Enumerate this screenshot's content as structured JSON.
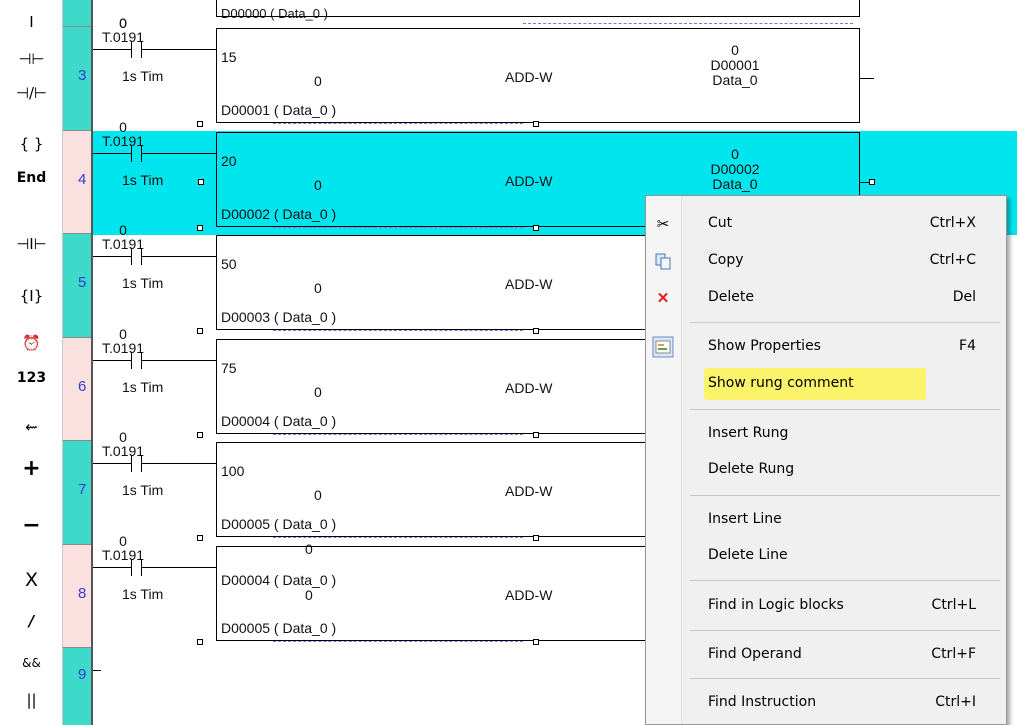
{
  "toolbar": [
    {
      "name": "contact-cursor-tool",
      "glyph": "I"
    },
    {
      "name": "normally-open-contact-tool",
      "glyph": "⊣⊢"
    },
    {
      "name": "normally-closed-contact-tool",
      "glyph": "⊣/⊢"
    },
    {
      "name": "coil-tool",
      "glyph": "{ }"
    },
    {
      "name": "end-tool",
      "glyph": "End"
    },
    {
      "name": "rising-edge-contact-tool",
      "glyph": "⊣I⊢"
    },
    {
      "name": "set-coil-tool",
      "glyph": "{I}"
    },
    {
      "name": "timer-tool",
      "glyph": "⏰"
    },
    {
      "name": "numeric-tool",
      "glyph": "123"
    },
    {
      "name": "move-tool",
      "glyph": "⇜"
    },
    {
      "name": "add-tool",
      "glyph": "+"
    },
    {
      "name": "subtract-tool",
      "glyph": "−"
    },
    {
      "name": "multiply-tool",
      "glyph": "X"
    },
    {
      "name": "divide-tool",
      "glyph": "/"
    },
    {
      "name": "logical-and-tool",
      "glyph": "&&"
    },
    {
      "name": "logical-or-tool",
      "glyph": "||"
    }
  ],
  "top_partial": {
    "zero": "0",
    "operand": "D00000 ( Data_0 )"
  },
  "rungs": [
    {
      "number": "3",
      "contact_value": "0",
      "contact_address": "T.0191",
      "contact_label": "1s Tim",
      "in1": "15",
      "in2_value": "0",
      "in2": "D00001 ( Data_0 )",
      "instruction": "ADD-W",
      "out_value": "0",
      "out_address": "D00001",
      "out_label": "Data_0",
      "selected": false
    },
    {
      "number": "4",
      "contact_value": "0",
      "contact_address": "T.0191",
      "contact_label": "1s Tim",
      "in1": "20",
      "in2_value": "0",
      "in2": "D00002 ( Data_0 )",
      "instruction": "ADD-W",
      "out_value": "0",
      "out_address": "D00002",
      "out_label": "Data_0",
      "selected": true
    },
    {
      "number": "5",
      "contact_value": "0",
      "contact_address": "T.0191",
      "contact_label": "1s Tim",
      "in1": "50",
      "in2_value": "0",
      "in2": "D00003 ( Data_0 )",
      "instruction": "ADD-W",
      "selected": false
    },
    {
      "number": "6",
      "contact_value": "0",
      "contact_address": "T.0191",
      "contact_label": "1s Tim",
      "in1": "75",
      "in2_value": "0",
      "in2": "D00004 ( Data_0 )",
      "instruction": "ADD-W",
      "selected": false
    },
    {
      "number": "7",
      "contact_value": "0",
      "contact_address": "T.0191",
      "contact_label": "1s Tim",
      "in1": "100",
      "in2_value": "0",
      "in2": "D00005 ( Data_0 )",
      "instruction": "ADD-W",
      "selected": false
    },
    {
      "number": "8",
      "contact_value": "0",
      "contact_address": "T.0191",
      "contact_label": "1s Tim",
      "in1_top": "0",
      "in1": "D00004 ( Data_0 )",
      "in2_value": "0",
      "in2": "D00005 ( Data_0 )",
      "instruction": "ADD-W",
      "selected": false
    },
    {
      "number": "9"
    }
  ],
  "context_menu": {
    "items": [
      {
        "label": "Cut",
        "shortcut": "Ctrl+X",
        "icon": "scissors-icon"
      },
      {
        "label": "Copy",
        "shortcut": "Ctrl+C",
        "icon": "copy-icon"
      },
      {
        "label": "Delete",
        "shortcut": "Del",
        "icon": "red-x-icon"
      },
      {
        "label": "Show Properties",
        "shortcut": "F4",
        "icon": "properties-icon"
      },
      {
        "label": "Show rung comment",
        "shortcut": "",
        "highlighted": true
      },
      {
        "label": "Insert Rung",
        "shortcut": ""
      },
      {
        "label": "Delete Rung",
        "shortcut": ""
      },
      {
        "label": "Insert Line",
        "shortcut": ""
      },
      {
        "label": "Delete Line",
        "shortcut": ""
      },
      {
        "label": "Find in Logic blocks",
        "shortcut": "Ctrl+L"
      },
      {
        "label": "Find Operand",
        "shortcut": "Ctrl+F"
      },
      {
        "label": "Find Instruction",
        "shortcut": "Ctrl+I"
      }
    ]
  },
  "colors": {
    "selected_rung": "#00e5ee",
    "rung_teal": "#3dd9c9",
    "rung_pink": "#fbe0e0",
    "highlight": "#fbf36a",
    "rung_number": "#2b3fd6"
  }
}
